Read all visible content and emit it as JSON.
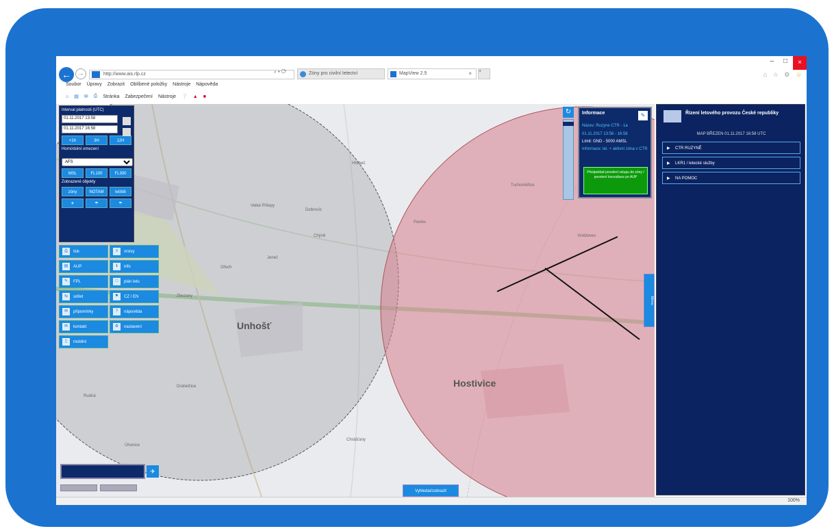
{
  "browser": {
    "address": "http://www.ais.rlp.cz",
    "address_controls": "⌕ ▾ ⟳",
    "tabs": [
      {
        "label": "Zóny pro civilní letectví"
      },
      {
        "label": "MapView 2.5"
      }
    ],
    "tab_close": "×",
    "new_tab": "+",
    "window_controls": {
      "minimize": "–",
      "maximize": "□",
      "close": "×"
    },
    "fav_icons": "⌂ ☆ ⚙",
    "smile_icon": "☺",
    "menu": [
      "Soubor",
      "Úpravy",
      "Zobrazit",
      "Oblíbené položky",
      "Nástroje",
      "Nápověda"
    ],
    "commands": [
      "Stránka",
      "Zabezpečení",
      "Nástroje"
    ]
  },
  "time_panel": {
    "label": "Interval platnosti (UTC)",
    "from": "01.11.2017 13:58",
    "to": "01.11.2017 16:58",
    "time_buttons": [
      "+1h",
      "3H",
      "12H"
    ],
    "airspace_label": "Horní/dolní omezení",
    "airspace_select": "AFS",
    "level_buttons": [
      "MSL",
      "FL100",
      "FL300"
    ],
    "object_label": "Zobrazené objekty",
    "object_buttons": [
      "zóny",
      "NOTAM",
      "letiště"
    ],
    "icon_buttons": [
      "✈",
      "☂",
      "☂"
    ]
  },
  "links": [
    {
      "label": "tisk",
      "icon": "⎙"
    },
    {
      "label": "vrstvy",
      "icon": "≡"
    },
    {
      "label": "AUP",
      "icon": "▤"
    },
    {
      "label": "info",
      "icon": "ℹ"
    },
    {
      "label": "FPL",
      "icon": "✎"
    },
    {
      "label": "plán letu",
      "icon": "□"
    },
    {
      "label": "sdílet",
      "icon": "⇆"
    },
    {
      "label": "CZ / EN",
      "icon": "⚑"
    },
    {
      "label": "připomínky",
      "icon": "✉"
    },
    {
      "label": "nápověda",
      "icon": "?"
    },
    {
      "label": "kontakt",
      "icon": "✉"
    },
    {
      "label": "nastavení",
      "icon": "⚙"
    },
    {
      "label": "mobilní",
      "icon": "▯"
    }
  ],
  "map": {
    "towns": [
      "Unhošť",
      "Hostivice"
    ],
    "small_towns": [
      "Hřebeč",
      "Velké Přílepy",
      "Dobrovíz",
      "Chýně",
      "Ořech",
      "Jeneč",
      "Zbuzany",
      "Tuchoměřice",
      "Kněževes",
      "Pavlov",
      "Rudná",
      "Chrášťany",
      "Úhonice",
      "Drahelčice"
    ],
    "search_placeholder": "",
    "search_icon": "✈",
    "bottom_button": "Vyhledat/zobrazit",
    "zoom_icon": "↻",
    "edge_tab": "Menu"
  },
  "popup": {
    "title": "Informace",
    "edit_icon": "✎",
    "line1": "Název: Ruzyne CTR - 1a",
    "line2": "01.11.2017 13:58 - 16:58",
    "line3": "Limit: GND - 5000 AMSL",
    "line4": "Informace: tel. + aktivní zóna v CTR",
    "green_text": "Předpoklad povolení vstupu do zóny / povolení konzultace po AUP"
  },
  "side": {
    "title": "Řízení letového provozu České republiky",
    "time": "MAP BŘEZEN 01.11.2017 16:58 UTC",
    "items": [
      "CTR RUZYNĚ",
      "LKR1 / letecké služby",
      "NA POMOC"
    ]
  },
  "status": {
    "zoom": "100%"
  }
}
